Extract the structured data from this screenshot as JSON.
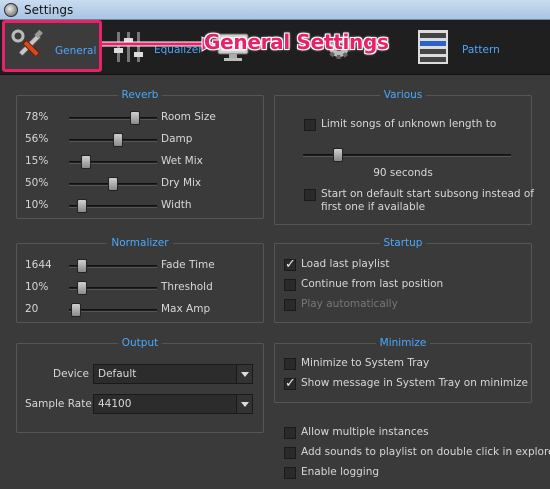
{
  "window": {
    "title": "Settings"
  },
  "tabs": [
    {
      "label": "General"
    },
    {
      "label": "Equalizer"
    },
    {
      "label": ""
    },
    {
      "label": ""
    },
    {
      "label": "Pattern"
    }
  ],
  "annotation": {
    "text": "General Settings"
  },
  "reverb": {
    "title": "Reverb",
    "rows": [
      {
        "value": "78%",
        "label": "Room Size",
        "level": 0.78
      },
      {
        "value": "56%",
        "label": "Damp",
        "level": 0.56
      },
      {
        "value": "15%",
        "label": "Wet Mix",
        "level": 0.15
      },
      {
        "value": "50%",
        "label": "Dry Mix",
        "level": 0.5
      },
      {
        "value": "10%",
        "label": "Width",
        "level": 0.1
      }
    ]
  },
  "normalizer": {
    "title": "Normalizer",
    "rows": [
      {
        "value": "1644",
        "label": "Fade Time",
        "level": 0.1
      },
      {
        "value": "10%",
        "label": "Threshold",
        "level": 0.1
      },
      {
        "value": "20",
        "label": "Max Amp",
        "level": 0.02
      }
    ]
  },
  "output": {
    "title": "Output",
    "device_label": "Device",
    "device_value": "Default",
    "sample_rate_label": "Sample Rate",
    "sample_rate_value": "44100"
  },
  "various": {
    "title": "Various",
    "limit_label": "Limit songs of unknown length to",
    "limit_checked": false,
    "seconds_text": "90 seconds",
    "seconds_level": 0.15,
    "start_default_label_1": "Start on default start subsong instead of",
    "start_default_label_2": "first one if available",
    "start_default_checked": false
  },
  "startup": {
    "title": "Startup",
    "items": [
      {
        "label": "Load last playlist",
        "checked": true,
        "disabled": false
      },
      {
        "label": "Continue from last position",
        "checked": false,
        "disabled": false
      },
      {
        "label": "Play automatically",
        "checked": false,
        "disabled": true
      }
    ]
  },
  "minimize": {
    "title": "Minimize",
    "items": [
      {
        "label": "Minimize to System Tray",
        "checked": false
      },
      {
        "label": "Show message in System Tray on minimize",
        "checked": true
      }
    ]
  },
  "misc": {
    "items": [
      {
        "label": "Allow multiple instances",
        "checked": false
      },
      {
        "label": "Add sounds to playlist on double click in explorer",
        "checked": false
      },
      {
        "label": "Enable logging",
        "checked": false
      }
    ]
  },
  "colors": {
    "accent": "#4aa8ff",
    "highlight": "#e8226a",
    "background": "#3a3a3a"
  }
}
